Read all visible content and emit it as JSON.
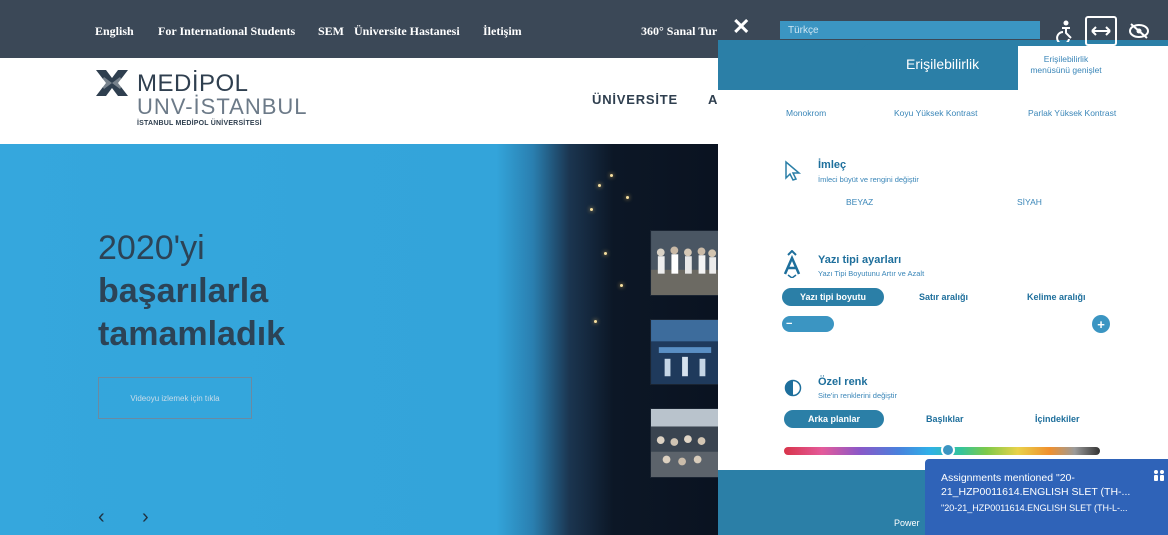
{
  "topbar": {
    "links": [
      "English",
      "For International Students",
      "SEM",
      "Üniversite Hastanesi",
      "İletişim"
    ],
    "virtual_tour": "360° Sanal Tur"
  },
  "header": {
    "logo_title": "MEDİPOL",
    "logo_sub": "UNV-İSTANBUL",
    "logo_small": "İSTANBUL MEDİPOL ÜNİVERSİTESİ",
    "nav": [
      "ÜNİVERSİTE",
      "A"
    ]
  },
  "hero": {
    "line1": "2020'yi",
    "line2": "başarılarla",
    "line3": "tamamladık",
    "button": "Videoyu izlemek için tıkla",
    "prev_arrow": "‹",
    "next_arrow": "›"
  },
  "panel": {
    "close": "✕",
    "language_value": "Türkçe",
    "tab_title": "Erişilebilirlik",
    "expand_note": "Erişilebilirlik menüsünü genişlet",
    "modes": [
      "Monokrom",
      "Koyu Yüksek Kontrast",
      "Parlak Yüksek Kontrast"
    ],
    "cursor": {
      "title": "İmleç",
      "subtitle": "İmleci büyüt ve rengini değiştir",
      "options": [
        "BEYAZ",
        "SİYAH"
      ]
    },
    "font": {
      "title": "Yazı tipi ayarları",
      "subtitle": "Yazı Tipi Boyutunu Artır ve Azalt",
      "options": [
        "Yazı tipi boyutu",
        "Satır aralığı",
        "Kelime aralığı"
      ],
      "minus": "−",
      "plus": "+"
    },
    "color": {
      "title": "Özel renk",
      "subtitle": "Site'in renklerini değiştir",
      "options": [
        "Arka planlar",
        "Başlıklar",
        "İçindekiler"
      ]
    },
    "powered": "Power"
  },
  "notification": {
    "title": "Assignments mentioned \"20-21_HZP0011614.ENGLISH SLET (TH-...",
    "line": "\"20-21_HZP0011614.ENGLISH SLET (TH-L-..."
  },
  "colors": {
    "topbar": "#3b4857",
    "panel_accent": "#2b7fa7",
    "hero_blue": "#35a7dd",
    "notification": "#2f63b8"
  }
}
